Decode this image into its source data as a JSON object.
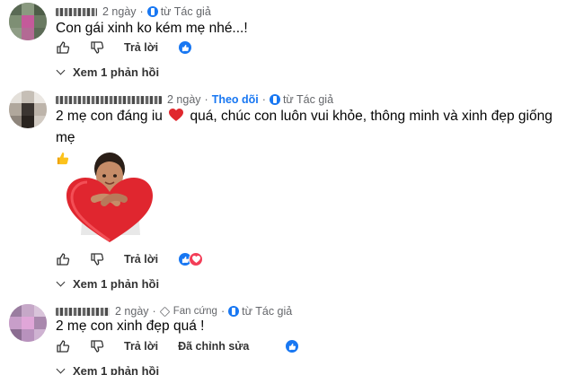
{
  "comments": [
    {
      "time": "2 ngày",
      "author_badge": "từ Tác giả",
      "text": "Con gái xinh ko kém mẹ nhé...!",
      "reply_label": "Trả lời",
      "replies_link": "Xem 1 phản hồi"
    },
    {
      "time": "2 ngày",
      "follow": "Theo dõi",
      "author_badge": "từ Tác giả",
      "text_before": "2 mẹ con đáng iu",
      "text_after": "quá, chúc con luôn vui khỏe, thông minh và xinh đẹp giống mẹ",
      "reply_label": "Trả lời",
      "replies_link": "Xem 1 phản hồi"
    },
    {
      "time": "2 ngày",
      "fan_label": "Fan cứng",
      "author_badge": "từ Tác giả",
      "text": "2 mẹ con xinh đẹp quá !",
      "reply_label": "Trả lời",
      "edited_label": "Đã chỉnh sửa",
      "replies_link": "Xem 1 phản hồi"
    }
  ],
  "colors": {
    "link_blue": "#1877f2",
    "secondary_text": "#65676b",
    "love_red": "#f33e58"
  }
}
